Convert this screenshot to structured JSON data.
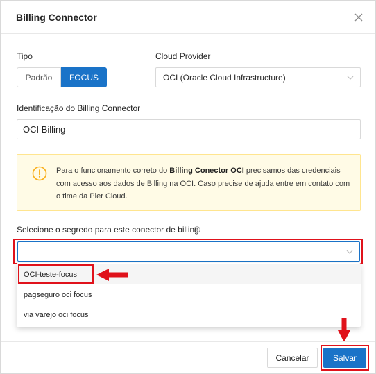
{
  "modal": {
    "title": "Billing Connector",
    "close_icon": "close-icon"
  },
  "tipo": {
    "label": "Tipo",
    "options": [
      {
        "label": "Padrão",
        "selected": false
      },
      {
        "label": "FOCUS",
        "selected": true
      }
    ]
  },
  "cloud_provider": {
    "label": "Cloud Provider",
    "value": "OCI (Oracle Cloud Infrastructure)"
  },
  "identificacao": {
    "label": "Identificação do Billing Connector",
    "value": "OCI Billing"
  },
  "alert": {
    "icon": "warning-icon",
    "text_before": "Para o funcionamento correto do ",
    "text_bold": "Billing Conector OCI",
    "text_after": " precisamos das credenciais com acesso aos dados de Billing na OCI. Caso precise de ajuda entre em contato com o time da Pier Cloud."
  },
  "secret": {
    "label": "Selecione o segredo para este conector de billing",
    "value": "",
    "options": [
      {
        "label": "OCI-teste-focus",
        "active": true
      },
      {
        "label": "pagseguro oci focus",
        "active": false
      },
      {
        "label": "via varejo oci focus",
        "active": false
      }
    ]
  },
  "footer": {
    "cancel_label": "Cancelar",
    "save_label": "Salvar"
  },
  "colors": {
    "primary": "#1a73c8",
    "highlight": "#e0121b",
    "warning": "#faad14",
    "alert_bg": "#fffbe6"
  }
}
